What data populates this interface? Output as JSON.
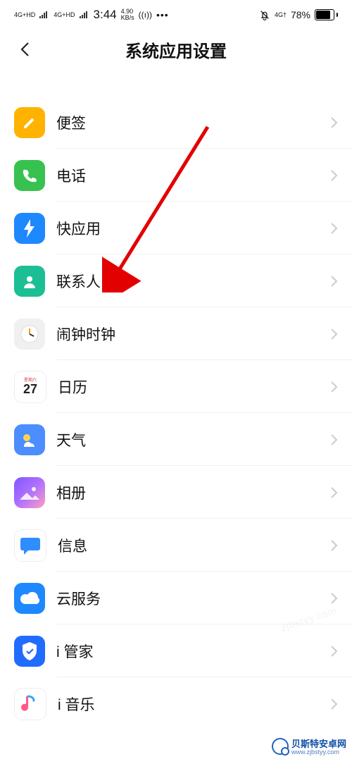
{
  "status": {
    "sig1": "4G+HD",
    "sig2": "4G+HD",
    "time": "3:44",
    "speed_num": "4.90",
    "speed_unit": "KB/s",
    "net_label": "4G†",
    "battery_pct": "78%"
  },
  "nav": {
    "title": "系统应用设置"
  },
  "apps": [
    {
      "id": "notes",
      "label": "便签"
    },
    {
      "id": "phone",
      "label": "电话"
    },
    {
      "id": "quick",
      "label": "快应用"
    },
    {
      "id": "contacts",
      "label": "联系人"
    },
    {
      "id": "clock",
      "label": "闹钟时钟"
    },
    {
      "id": "calendar",
      "label": "日历",
      "cal_day": "27",
      "cal_top": "星期六"
    },
    {
      "id": "weather",
      "label": "天气"
    },
    {
      "id": "album",
      "label": "相册"
    },
    {
      "id": "message",
      "label": "信息"
    },
    {
      "id": "cloud",
      "label": "云服务"
    },
    {
      "id": "manager",
      "label": "i 管家"
    },
    {
      "id": "music",
      "label": "i 音乐"
    }
  ],
  "watermark": {
    "brand": "贝斯特安卓网",
    "url": "www.zjbstyy.com"
  }
}
